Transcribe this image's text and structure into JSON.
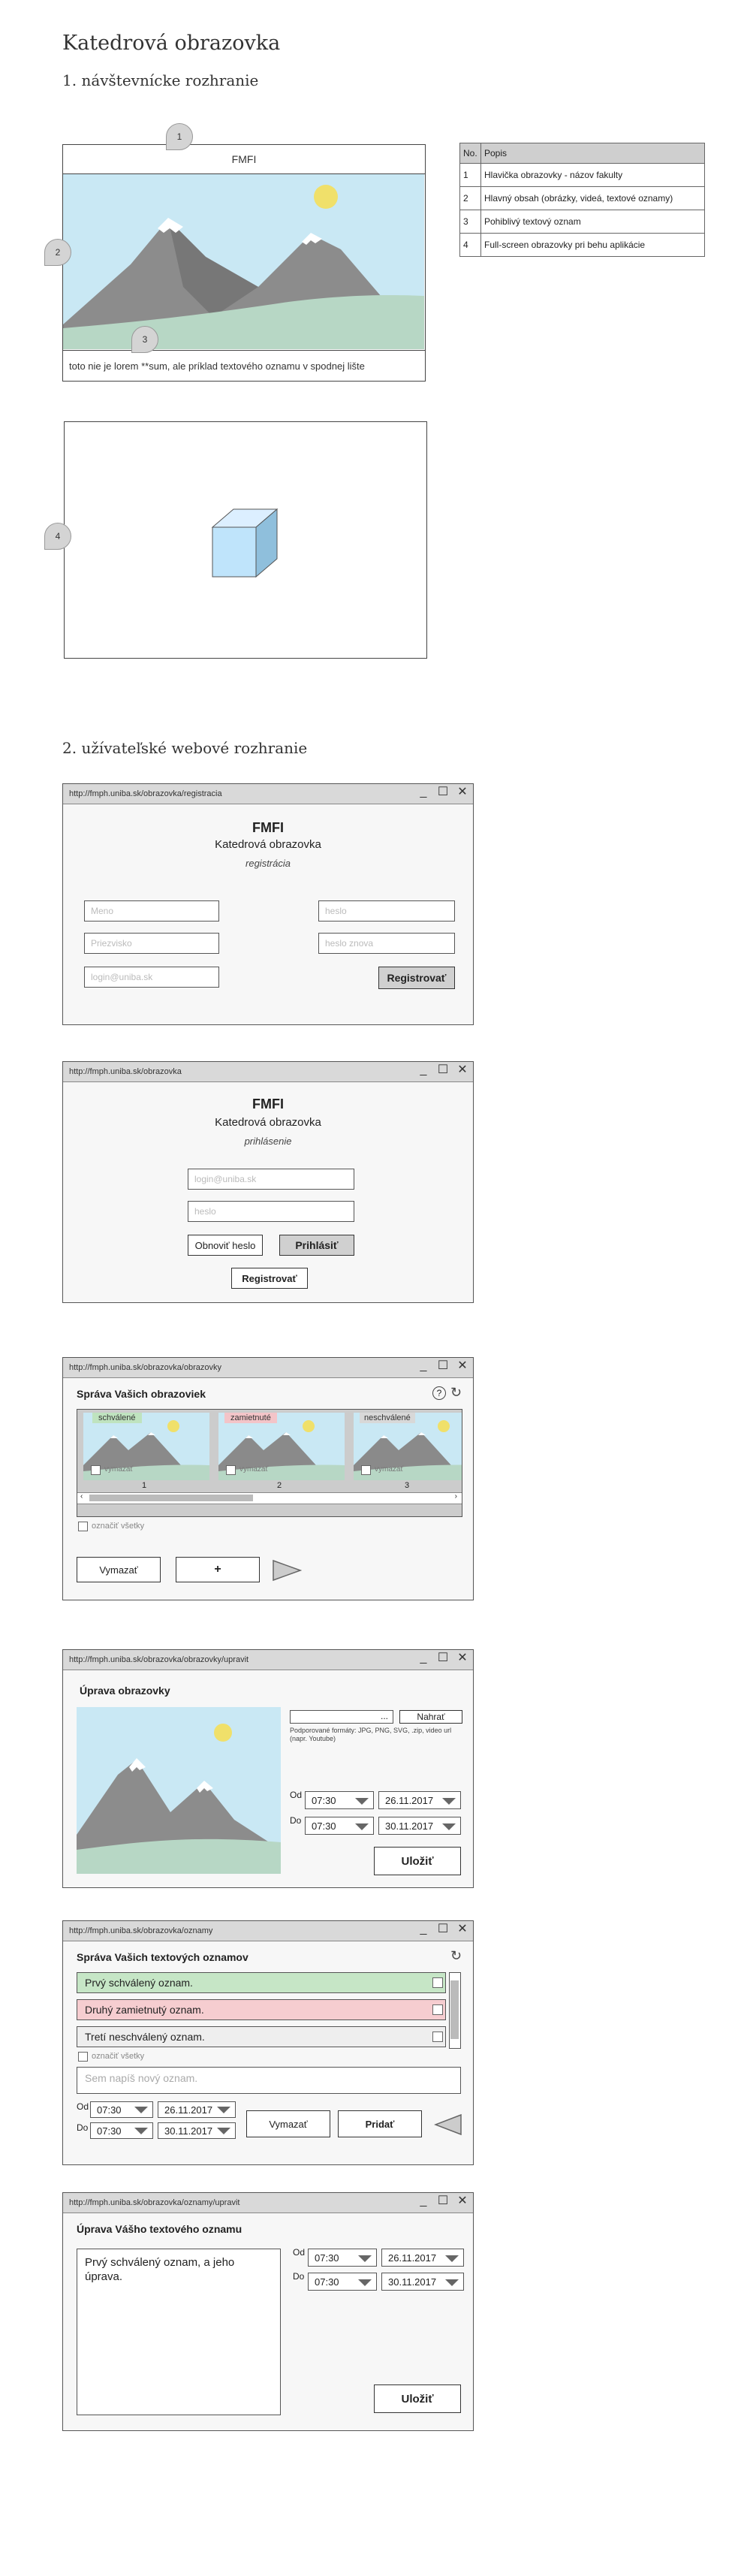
{
  "page": {
    "title": "Katedrová obrazovka",
    "section1": "1. návštevnícke rozhranie",
    "section2": "2. užívateľské webové rozhranie"
  },
  "visitor": {
    "header_text": "FMFI",
    "ticker_text": "toto nie je lorem **sum, ale príklad textového oznamu v spodnej lište",
    "callouts": [
      "1",
      "2",
      "3",
      "4"
    ]
  },
  "legend": {
    "headers": [
      "No.",
      "Popis"
    ],
    "rows": [
      [
        "1",
        "Hlavička obrazovky - názov fakulty"
      ],
      [
        "2",
        "Hlavný obsah (obrázky, videá, textové oznamy)"
      ],
      [
        "3",
        "Pohiblivý textový oznam"
      ],
      [
        "4",
        "Full-screen obrazovky pri behu aplikácie"
      ]
    ]
  },
  "register": {
    "url": "http://fmph.uniba.sk/obrazovka/registracia",
    "title": "FMFI",
    "subtitle": "Katedrová obrazovka",
    "caption": "registrácia",
    "name_ph": "Meno",
    "surname_ph": "Priezvisko",
    "login_ph": "login@uniba.sk",
    "pass_ph": "heslo",
    "pass2_ph": "heslo znova",
    "submit": "Registrovať"
  },
  "login": {
    "url": "http://fmph.uniba.sk/obrazovka",
    "title": "FMFI",
    "subtitle": "Katedrová obrazovka",
    "caption": "prihlásenie",
    "login_ph": "login@uniba.sk",
    "pass_ph": "heslo",
    "reset": "Obnoviť heslo",
    "submit": "Prihlásiť",
    "register": "Registrovať"
  },
  "screens": {
    "url": "http://fmph.uniba.sk/obrazovka/obrazovky",
    "heading": "Správa Vašich obrazoviek",
    "items": [
      {
        "badge": "schválené",
        "badge_color": "#bfe3bf",
        "delete": "vymazať",
        "num": "1"
      },
      {
        "badge": "zamietnuté",
        "badge_color": "#f3c4c8",
        "delete": "vymazať",
        "num": "2"
      },
      {
        "badge": "neschválené",
        "badge_color": "#d8d8d8",
        "delete": "vymazať",
        "num": "3"
      }
    ],
    "select_all": "označiť všetky",
    "delete_btn": "Vymazať",
    "add_btn": "+"
  },
  "edit_screen": {
    "url": "http://fmph.uniba.sk/obrazovka/obrazovky/upravit",
    "heading": "Úprava obrazovky",
    "file_btn": "...",
    "upload_btn": "Nahrať",
    "formats_note": "Podporované formáty: JPG, PNG, SVG, .zip, video url (napr. Youtube)",
    "from_label": "Od",
    "to_label": "Do",
    "from_time": "07:30",
    "from_date": "26.11.2017",
    "to_time": "07:30",
    "to_date": "30.11.2017",
    "save": "Uložiť"
  },
  "notices": {
    "url": "http://fmph.uniba.sk/obrazovka/oznamy",
    "heading": "Správa Vašich textových oznamov",
    "items": [
      {
        "text": "Prvý schválený oznam.",
        "color": "#c6e6c6"
      },
      {
        "text": "Druhý zamietnutý oznam.",
        "color": "#f6cdd0"
      },
      {
        "text": "Tretí neschválený oznam.",
        "color": "#eeeeee"
      }
    ],
    "select_all": "označiť všetky",
    "new_ph": "Sem napíš nový oznam.",
    "from_label": "Od",
    "to_label": "Do",
    "from_time": "07:30",
    "from_date": "26.11.2017",
    "to_time": "07:30",
    "to_date": "30.11.2017",
    "delete_btn": "Vymazať",
    "add_btn": "Pridať"
  },
  "edit_notice": {
    "url": "http://fmph.uniba.sk/obrazovka/oznamy/upravit",
    "heading": "Úprava Vášho textového oznamu",
    "text": "Prvý schválený oznam, a jeho úprava.",
    "from_label": "Od",
    "to_label": "Do",
    "from_time": "07:30",
    "from_date": "26.11.2017",
    "to_time": "07:30",
    "to_date": "30.11.2017",
    "save": "Uložiť"
  }
}
